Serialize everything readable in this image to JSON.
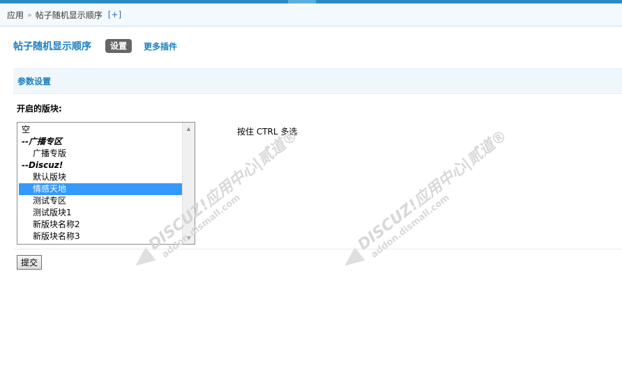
{
  "breadcrumb": {
    "root": "应用",
    "separator": "»",
    "current": "帖子随机显示顺序",
    "add_link": "[+]"
  },
  "header": {
    "plugin_title": "帖子随机显示顺序",
    "settings_tab": "设置",
    "more_plugins": "更多插件"
  },
  "section": {
    "title": "参数设置"
  },
  "field": {
    "label": "开启的版块:",
    "hint": "按住 CTRL 多选",
    "options": [
      {
        "label": "空",
        "type": "option",
        "selected": false
      },
      {
        "label": "--广播专区",
        "type": "group",
        "selected": false
      },
      {
        "label": "广播专版",
        "type": "child",
        "selected": false
      },
      {
        "label": "--Discuz!",
        "type": "group",
        "selected": false
      },
      {
        "label": "默认版块",
        "type": "child",
        "selected": false
      },
      {
        "label": "情感天地",
        "type": "child",
        "selected": true
      },
      {
        "label": "测试专区",
        "type": "child",
        "selected": false
      },
      {
        "label": "测试版块1",
        "type": "child",
        "selected": false
      },
      {
        "label": "新版块名称2",
        "type": "child",
        "selected": false
      },
      {
        "label": "新版块名称3",
        "type": "child",
        "selected": false
      }
    ]
  },
  "actions": {
    "submit_label": "提交"
  },
  "watermark": {
    "line1": "DISCUZ!应用中心|贰道®",
    "line2": "addon.dismall.com"
  },
  "colors": {
    "accent": "#1a7fc2",
    "top_bar": "#2b8cc4",
    "selected_option": "#3399ff",
    "section_bg": "#f0f7fc"
  }
}
